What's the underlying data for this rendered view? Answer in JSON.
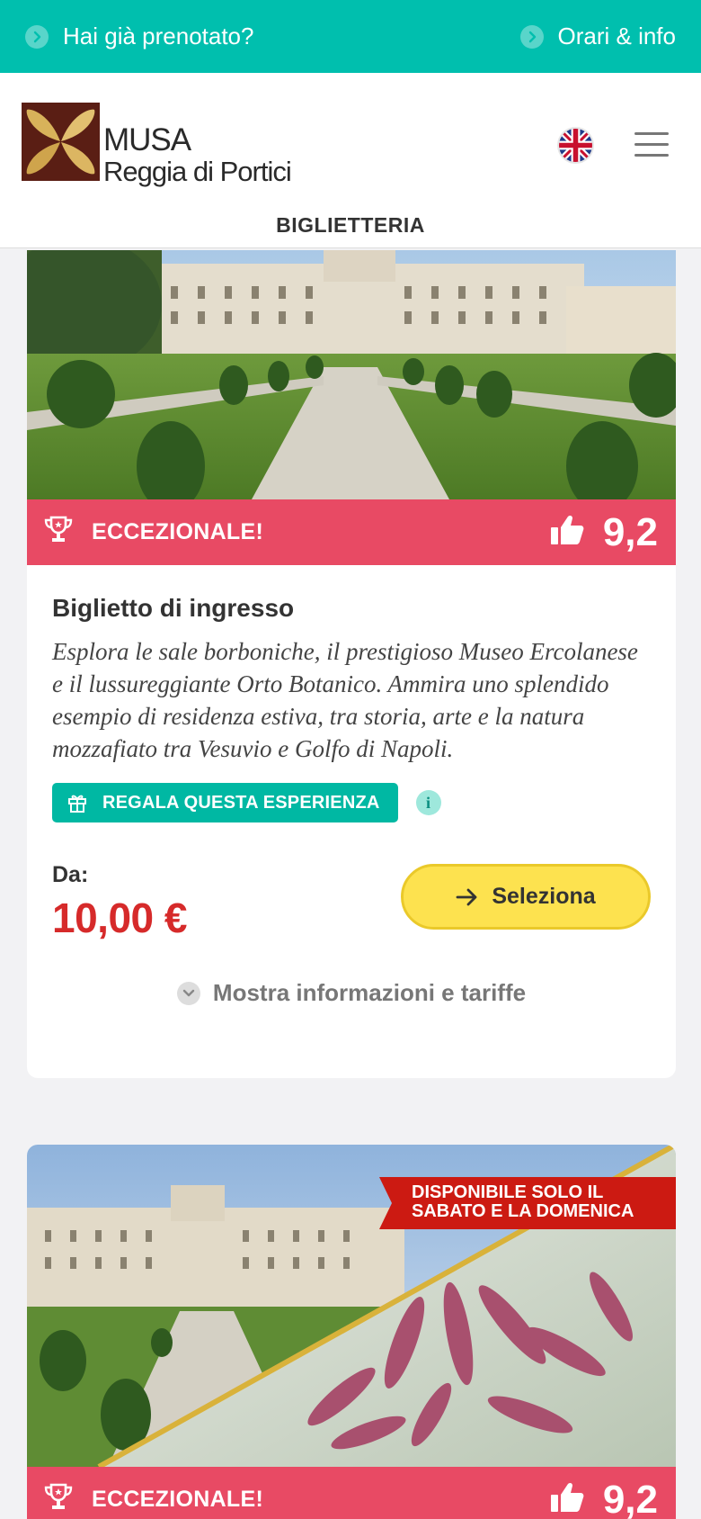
{
  "topbar": {
    "left_link": "Hai già prenotato?",
    "right_link": "Orari & info",
    "color": "#00bfae"
  },
  "header": {
    "logo_line1": "MUSA",
    "logo_line2": "Reggia di Portici",
    "language_icon": "uk-flag-icon",
    "menu_icon": "hamburger-icon",
    "section_tab": "BIGLIETTERIA"
  },
  "cards": [
    {
      "badge": "ECCEZIONALE!",
      "score": "9,2",
      "title": "Biglietto di ingresso",
      "description": "Esplora le sale borboniche, il prestigioso Museo Ercolanese e il lussureggiante Orto Botanico. Ammira uno splendido esempio di residenza estiva, tra storia, arte e la natura mozzafiato tra Vesuvio e Golfo di Napoli.",
      "gift_button": "REGALA QUESTA ESPERIENZA",
      "price_prefix": "Da:",
      "price": "10,00 €",
      "select_button": "Seleziona",
      "more_info": "Mostra informazioni e tariffe"
    },
    {
      "ribbon_line1": "DISPONIBILE SOLO IL",
      "ribbon_line2": "SABATO E LA DOMENICA",
      "badge": "ECCEZIONALE!",
      "score": "9,2"
    }
  ],
  "colors": {
    "badge": "#e84a64",
    "price": "#d62a2a",
    "select": "#fde24f",
    "gift": "#00b8a3",
    "ribbon": "#cc1a12"
  }
}
